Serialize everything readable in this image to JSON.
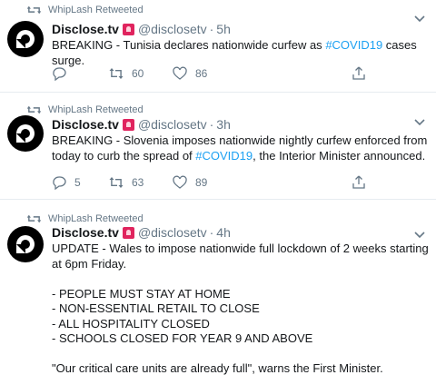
{
  "tweets": [
    {
      "retweeted_by": "WhipLash Retweeted",
      "name": "Disclose.tv",
      "handle": "@disclosetv",
      "time": "5h",
      "text_before": "BREAKING - Tunisia declares nationwide curfew as ",
      "hashtag": "#COVID19",
      "text_after": " cases surge.",
      "retweets": "60",
      "likes": "86"
    },
    {
      "retweeted_by": "WhipLash Retweeted",
      "name": "Disclose.tv",
      "handle": "@disclosetv",
      "time": "3h",
      "text_before": "BREAKING - Slovenia imposes nationwide nightly curfew enforced from today to curb the spread of ",
      "hashtag": "#COVID19",
      "text_after": ", the Interior Minister announced.",
      "replies": "5",
      "retweets": "63",
      "likes": "89"
    },
    {
      "retweeted_by": "WhipLash Retweeted",
      "name": "Disclose.tv",
      "handle": "@disclosetv",
      "time": "4h",
      "text_before": "UPDATE - Wales to impose nationwide full lockdown of 2 weeks starting at 6pm Friday.\n\n- PEOPLE MUST STAY AT HOME\n- NON-ESSENTIAL RETAIL TO CLOSE\n- ALL HOSPITALITY CLOSED\n- SCHOOLS CLOSED FOR YEAR 9 AND ABOVE\n\n\"Our critical care units are already full\", warns the First Minister.",
      "hashtag": "",
      "text_after": ""
    }
  ],
  "dot": "·",
  "colors": {
    "link": "#1da1f2",
    "secondary": "#657786",
    "siren": "#e0245e",
    "divider": "#e6ecf0"
  },
  "icons": {
    "retweeted": "retweet-icon",
    "avatar": "disclose-logo-icon",
    "badge": "siren-emoji-icon",
    "reply": "reply-icon",
    "retweet": "retweet-icon",
    "like": "heart-icon",
    "share": "share-icon",
    "more": "chevron-down-icon"
  }
}
